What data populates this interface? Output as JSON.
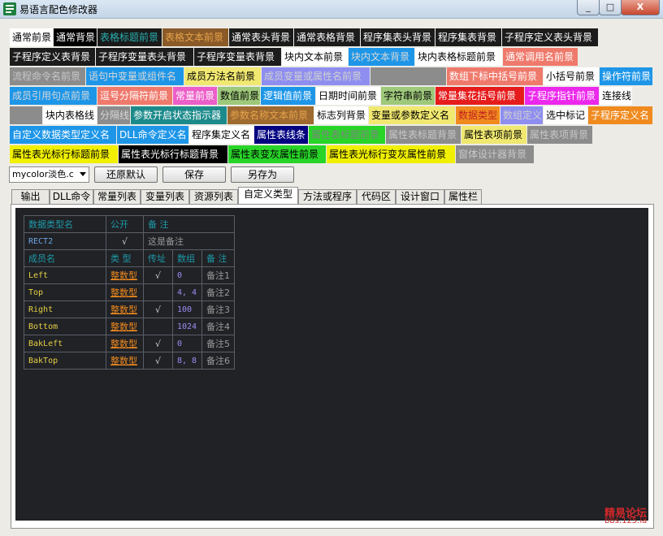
{
  "window": {
    "title": "易语言配色修改器",
    "minimize": "_",
    "maximize": "□",
    "close": "X"
  },
  "swatches": [
    {
      "label": "通常前景",
      "bg": "#ffffff",
      "fg": "#000000"
    },
    {
      "label": "通常背景",
      "bg": "#000000",
      "fg": "#ffffff"
    },
    {
      "label": "表格标题前景",
      "bg": "#1a1a1a",
      "fg": "#2aaeb0"
    },
    {
      "label": "表格文本前景",
      "bg": "#8a5a28",
      "fg": "#e6a34c"
    },
    {
      "label": "通常表头背景",
      "bg": "#1c1c1c",
      "fg": "#ffffff"
    },
    {
      "label": "通常表格背景",
      "bg": "#1c1c1c",
      "fg": "#ffffff"
    },
    {
      "label": "程序集表头背景",
      "bg": "#1c1c1c",
      "fg": "#ffffff"
    },
    {
      "label": "程序集表背景",
      "bg": "#1c1c1c",
      "fg": "#ffffff"
    },
    {
      "label": "子程序定义表头背景",
      "bg": "#1c1c1c",
      "fg": "#ffffff"
    },
    {
      "label": "子程序定义表背景",
      "bg": "#1c1c1c",
      "fg": "#ffffff"
    },
    {
      "label": "子程序变量表头背景",
      "bg": "#1c1c1c",
      "fg": "#ffffff"
    },
    {
      "label": "子程序变量表背景",
      "bg": "#1c1c1c",
      "fg": "#ffffff"
    },
    {
      "label": "块内文本前景",
      "bg": "#ffffff",
      "fg": "#000000"
    },
    {
      "label": "块内文本背景",
      "bg": "#1e96e8",
      "fg": "#d8d8d8"
    },
    {
      "label": "块内表格标题前景",
      "bg": "#ffffff",
      "fg": "#000000"
    },
    {
      "label": "通常调用名前景",
      "bg": "#ef7a6c",
      "fg": "#ffffff"
    },
    {
      "label": "流程命令名前景",
      "bg": "#8c8c8c",
      "fg": "#c8c8c8"
    },
    {
      "label": "语句中变量或组件名",
      "bg": "#1e96e8",
      "fg": "#d8d8d8"
    },
    {
      "label": "成员方法名前景",
      "bg": "#f0e870",
      "fg": "#000000"
    },
    {
      "label": "成员变量或属性名前景",
      "bg": "#8e8ef0",
      "fg": "#d0d0d0"
    },
    {
      "label": "",
      "bg": "#8c8c8c",
      "fg": "#ffffff"
    },
    {
      "label": "数组下标中括号前景",
      "bg": "#ef7a6c",
      "fg": "#ffffff"
    },
    {
      "label": "小括号前景",
      "bg": "#ffffff",
      "fg": "#000000"
    },
    {
      "label": "操作符前景",
      "bg": "#1e96e8",
      "fg": "#ffffff"
    },
    {
      "label": "成员引用句点前景",
      "bg": "#1e96e8",
      "fg": "#d8d8d8"
    },
    {
      "label": "逗号分隔符前景",
      "bg": "#ef7a6c",
      "fg": "#ffffff"
    },
    {
      "label": "常量前景",
      "bg": "#ec5ec8",
      "fg": "#ffffff"
    },
    {
      "label": "数值前景",
      "bg": "#9ec87a",
      "fg": "#000000"
    },
    {
      "label": "逻辑值前景",
      "bg": "#1e96e8",
      "fg": "#ffffff"
    },
    {
      "label": "日期时间前景",
      "bg": "#ffffff",
      "fg": "#000000"
    },
    {
      "label": "字符串前景",
      "bg": "#9ec87a",
      "fg": "#000000"
    },
    {
      "label": "常量集花括号前景",
      "bg": "#e61c1c",
      "fg": "#ffffff"
    },
    {
      "label": "子程序指针前景",
      "bg": "#ec28ec",
      "fg": "#ffffff"
    },
    {
      "label": "连接线",
      "bg": "#ffffff",
      "fg": "#000000"
    },
    {
      "label": "",
      "bg": "#8c8c8c",
      "fg": "#ffffff"
    },
    {
      "label": "块内表格线",
      "bg": "#ffffff",
      "fg": "#000000"
    },
    {
      "label": "分隔线",
      "bg": "#8c8c8c",
      "fg": "#d8d8d8"
    },
    {
      "label": "参数开启状态指示器",
      "bg": "#1c8a8a",
      "fg": "#ffffff"
    },
    {
      "label": "参数名称文本前景",
      "bg": "#9e6a30",
      "fg": "#e6a34c"
    },
    {
      "label": "标志列背景",
      "bg": "#ffffff",
      "fg": "#000000"
    },
    {
      "label": "变量或参数定义名",
      "bg": "#f0e870",
      "fg": "#000000"
    },
    {
      "label": "数据类型",
      "bg": "#f08a1e",
      "fg": "#c02020"
    },
    {
      "label": "数组定义",
      "bg": "#8e8ef0",
      "fg": "#d0d0d0"
    },
    {
      "label": "选中标记",
      "bg": "#ffffff",
      "fg": "#000000"
    },
    {
      "label": "子程序定义名",
      "bg": "#f08a1e",
      "fg": "#ffffff"
    },
    {
      "label": "自定义数据类型定义名",
      "bg": "#1e96e8",
      "fg": "#ffffff"
    },
    {
      "label": "DLL命令定义名",
      "bg": "#1e96e8",
      "fg": "#ffffff"
    },
    {
      "label": "程序集定义名",
      "bg": "#ffffff",
      "fg": "#000000"
    },
    {
      "label": "属性表线条",
      "bg": "#000080",
      "fg": "#ffffff"
    },
    {
      "label": "属性表标题前景",
      "bg": "#28d428",
      "fg": "#808080"
    },
    {
      "label": "属性表标题背景",
      "bg": "#8c8c8c",
      "fg": "#c8c8c8"
    },
    {
      "label": "属性表项前景",
      "bg": "#f0e870",
      "fg": "#000000"
    },
    {
      "label": "属性表项背景",
      "bg": "#8c8c8c",
      "fg": "#c8c8c8"
    },
    {
      "label": "属性表光标行标题前景",
      "bg": "#f0f000",
      "fg": "#000000"
    },
    {
      "label": "属性表光标行标题背景",
      "bg": "#000000",
      "fg": "#ffffff"
    },
    {
      "label": "属性表变灰属性前景",
      "bg": "#28d428",
      "fg": "#000000"
    },
    {
      "label": "属性表光标行变灰属性前景",
      "bg": "#f0f000",
      "fg": "#000000"
    },
    {
      "label": "窗体设计器背景",
      "bg": "#8c8c8c",
      "fg": "#c8c8c8"
    }
  ],
  "scheme_select": {
    "value": "mycolor淡色.c"
  },
  "buttons": {
    "restore": "还原默认",
    "save": "保存",
    "save_as": "另存为"
  },
  "tabs": [
    "输出",
    "DLL命令",
    "常量列表",
    "变量列表",
    "资源列表",
    "自定义类型",
    "方法或程序",
    "代码区",
    "设计窗口",
    "属性栏"
  ],
  "active_tab": 5,
  "type_table": {
    "header": {
      "name": "数据类型名",
      "public": "公开",
      "note": "备 注"
    },
    "type_row": {
      "name": "RECT2",
      "public": "√",
      "note": "这是备注"
    },
    "member_header": {
      "name": "成员名",
      "type": "类 型",
      "ref": "传址",
      "array": "数组",
      "note": "备 注"
    },
    "members": [
      {
        "name": "Left",
        "type": "整数型",
        "ref": "√",
        "array": "0",
        "note": "备注1"
      },
      {
        "name": "Top",
        "type": "整数型",
        "ref": "",
        "array": "4, 4",
        "note": "备注2"
      },
      {
        "name": "Right",
        "type": "整数型",
        "ref": "√",
        "array": "100",
        "note": "备注3"
      },
      {
        "name": "Bottom",
        "type": "整数型",
        "ref": "",
        "array": "1024",
        "note": "备注4"
      },
      {
        "name": "BakLeft",
        "type": "整数型",
        "ref": "√",
        "array": "0",
        "note": "备注5"
      },
      {
        "name": "BakTop",
        "type": "整数型",
        "ref": "√",
        "array": "8, 8",
        "note": "备注6"
      }
    ]
  },
  "watermark": {
    "line1": "精易论坛",
    "line2": "bbs.125.la"
  }
}
